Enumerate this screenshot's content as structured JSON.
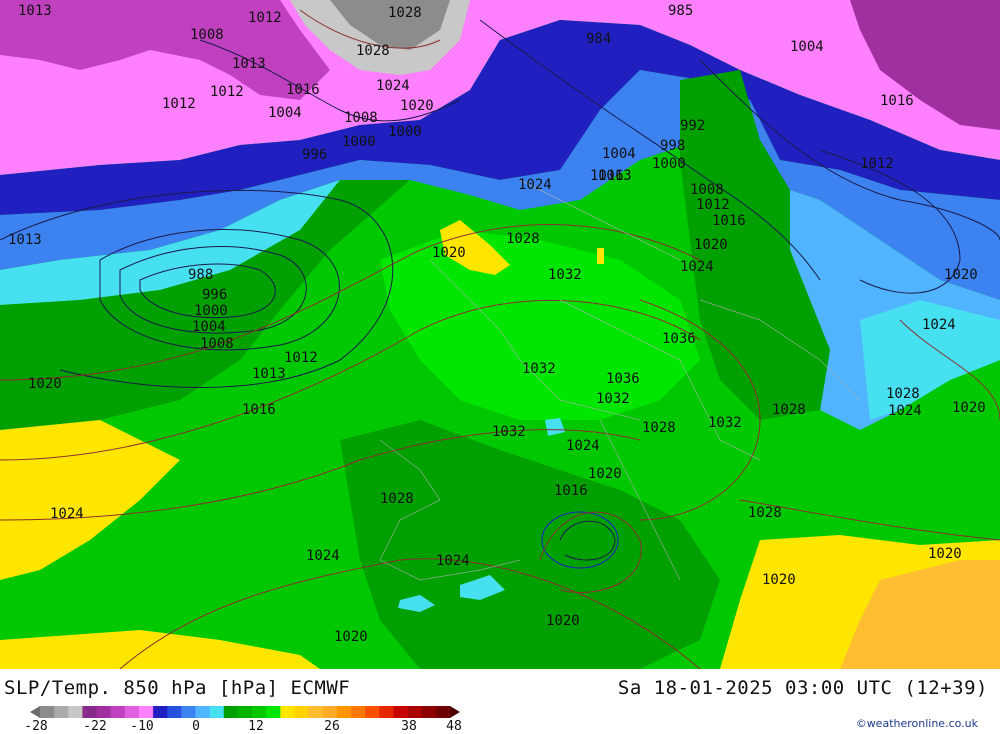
{
  "title": "SLP/Temp. 850 hPa [hPa] ECMWF",
  "valid_time": "Sa 18-01-2025 03:00 UTC (12+39)",
  "credit": "©weatheronline.co.uk",
  "colorbar": {
    "tick_labels": [
      "-28",
      "-22",
      "-10",
      "0",
      "12",
      "26",
      "38",
      "48"
    ],
    "colors": [
      "#6e6e6e",
      "#8c8c8c",
      "#aaaaaa",
      "#c8c8c8",
      "#8a2a8a",
      "#a030a0",
      "#c040c0",
      "#e060e0",
      "#ff80ff",
      "#2020c0",
      "#2850e0",
      "#3c82f0",
      "#50b4ff",
      "#46e0f0",
      "#00a000",
      "#00b400",
      "#00c800",
      "#00e600",
      "#ffe600",
      "#ffd200",
      "#ffbe32",
      "#ffaa28",
      "#ff9600",
      "#ff7800",
      "#ff5000",
      "#e62800",
      "#c80000",
      "#aa0000",
      "#8c0000",
      "#6e0000",
      "#500000"
    ]
  },
  "isobar_labels": [
    "1013",
    "1012",
    "1028",
    "985",
    "1008",
    "1013",
    "1028",
    "984",
    "1004",
    "1016",
    "1012",
    "1024",
    "1016",
    "1012",
    "1004",
    "1020",
    "1008",
    "992",
    "1000",
    "996",
    "1000",
    "998",
    "1012",
    "1004",
    "1000",
    "1016",
    "1024",
    "1013",
    "1008",
    "1012",
    "1016",
    "1013",
    "1020",
    "1028",
    "1020",
    "1024",
    "1020",
    "988",
    "1032",
    "996",
    "1000",
    "1004",
    "1008",
    "1012",
    "1013",
    "1036",
    "1020",
    "1024",
    "1016",
    "1032",
    "1036",
    "1028",
    "1032",
    "1028",
    "1032",
    "1032",
    "1028",
    "1024",
    "1024",
    "1020",
    "1020",
    "1016",
    "1028",
    "1028",
    "1024",
    "1024",
    "1020",
    "1024",
    "1020",
    "1020",
    "1020"
  ]
}
